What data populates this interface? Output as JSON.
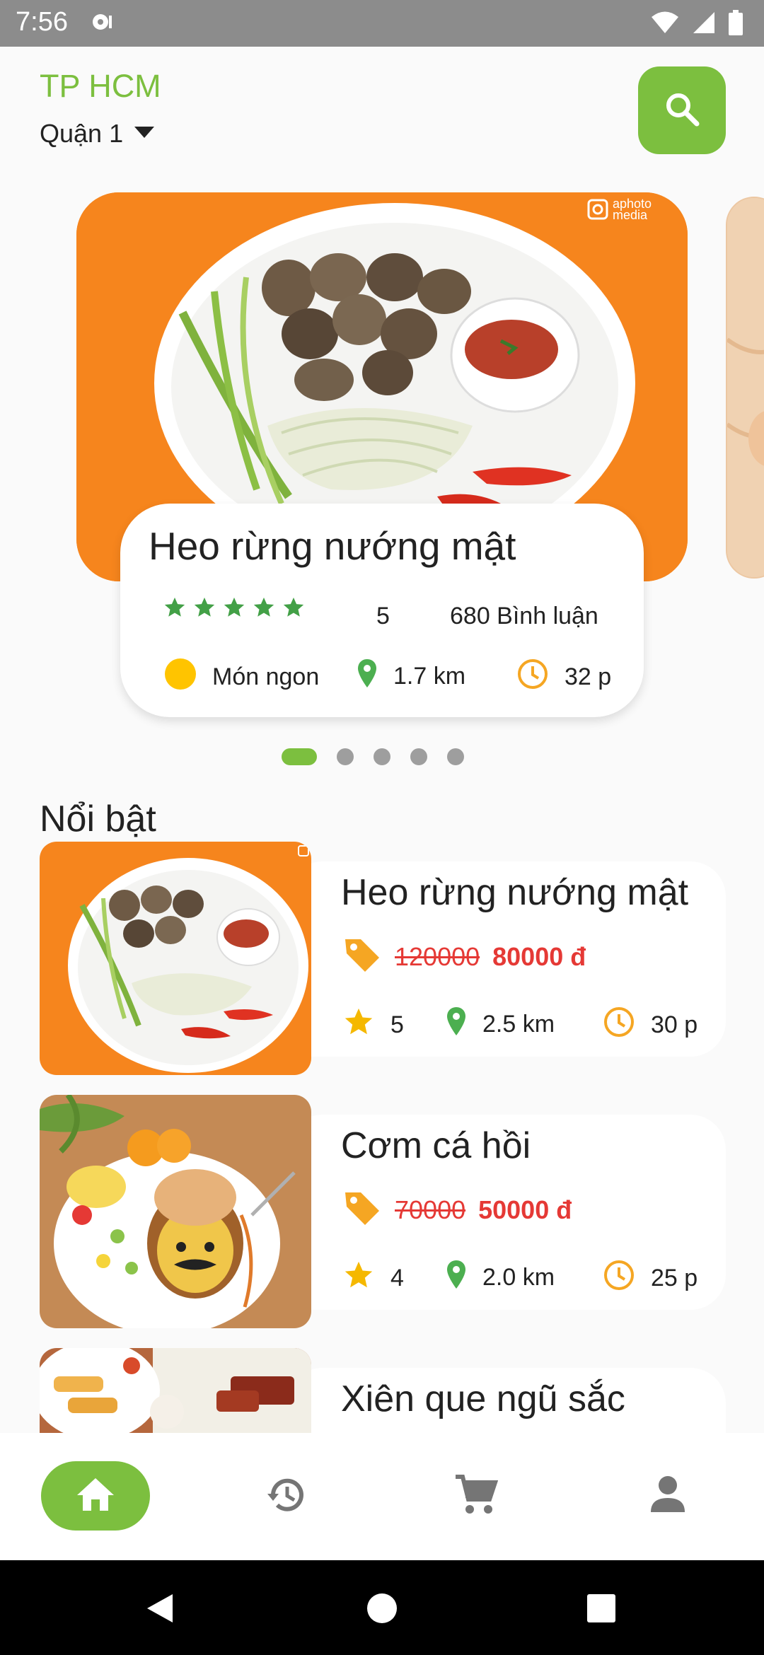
{
  "status": {
    "time": "7:56"
  },
  "header": {
    "city": "TP HCM",
    "district": "Quận 1"
  },
  "carousel": {
    "watermark": "aphoto media",
    "featured": {
      "title": "Heo rừng nướng mật",
      "rating": "5",
      "star_count": 5,
      "reviews": "680 Bình luận",
      "tag": "Món ngon",
      "distance": "1.7 km",
      "time": "32 p"
    },
    "page_count": 5,
    "active_page": 0
  },
  "section": {
    "title": "Nổi bật"
  },
  "foods": [
    {
      "name": "Heo rừng nướng mật",
      "old_price": "120000",
      "new_price": "80000 đ",
      "rating": "5",
      "distance": "2.5 km",
      "time": "30 p"
    },
    {
      "name": "Cơm cá hồi",
      "old_price": "70000",
      "new_price": "50000 đ",
      "rating": "4",
      "distance": "2.0 km",
      "time": "25 p"
    },
    {
      "name": "Xiên que ngũ sắc"
    }
  ],
  "colors": {
    "accent": "#7cbf3f",
    "price": "#e53935",
    "star": "#f5b800",
    "clock": "#f5a623",
    "orange_bg": "#f6851d"
  },
  "icons": [
    "search-icon",
    "chevron-down-icon",
    "star-icon",
    "location-pin-icon",
    "clock-icon",
    "price-tag-icon",
    "home-icon",
    "history-icon",
    "cart-icon",
    "account-icon",
    "back-icon",
    "home-circle-icon",
    "recents-icon"
  ]
}
